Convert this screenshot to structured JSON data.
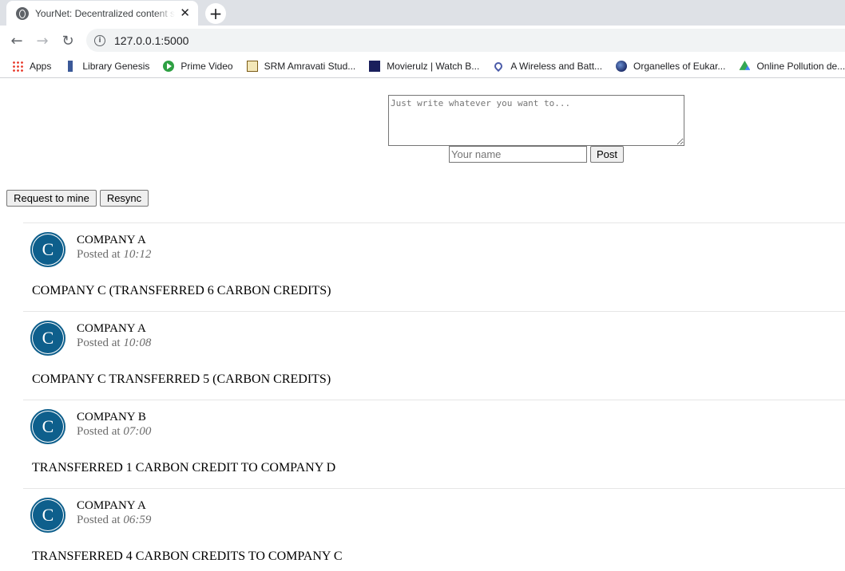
{
  "browser": {
    "tab_title": "YourNet: Decentralized content sharing",
    "tab_close": "✕",
    "new_tab": "+",
    "url": "127.0.0.1:5000",
    "bookmarks": [
      {
        "label": "Apps",
        "icon": "apps-grid-icon"
      },
      {
        "label": "Library Genesis",
        "icon": "library-genesis-icon"
      },
      {
        "label": "Prime Video",
        "icon": "prime-video-icon"
      },
      {
        "label": "SRM Amravati Stud...",
        "icon": "srm-icon"
      },
      {
        "label": "Movierulz | Watch B...",
        "icon": "movierulz-icon"
      },
      {
        "label": "A Wireless and Batt...",
        "icon": "wireless-icon"
      },
      {
        "label": "Organelles of Eukar...",
        "icon": "organelles-icon"
      },
      {
        "label": "Online Pollution de...",
        "icon": "google-drive-icon"
      }
    ]
  },
  "composer": {
    "placeholder": "Just write whatever you want to...",
    "name_placeholder": "Your name",
    "post_label": "Post"
  },
  "actions": {
    "mine_label": "Request to mine",
    "resync_label": "Resync"
  },
  "posts": [
    {
      "avatar": "C",
      "author": "COMPANY A",
      "posted_prefix": "Posted at",
      "time": "10:12",
      "content": "COMPANY C (TRANSFERRED 6 CARBON CREDITS)"
    },
    {
      "avatar": "C",
      "author": "COMPANY A",
      "posted_prefix": "Posted at",
      "time": "10:08",
      "content": "COMPANY C TRANSFERRED 5 (CARBON CREDITS)"
    },
    {
      "avatar": "C",
      "author": "COMPANY B",
      "posted_prefix": "Posted at",
      "time": "07:00",
      "content": "TRANSFERRED 1 CARBON CREDIT TO COMPANY D"
    },
    {
      "avatar": "C",
      "author": "COMPANY A",
      "posted_prefix": "Posted at",
      "time": "06:59",
      "content": "TRANSFERRED 4 CARBON CREDITS TO COMPANY C"
    }
  ],
  "colors": {
    "avatar_bg": "#0e5f8c",
    "chrome_tabstrip": "#dee1e6"
  }
}
